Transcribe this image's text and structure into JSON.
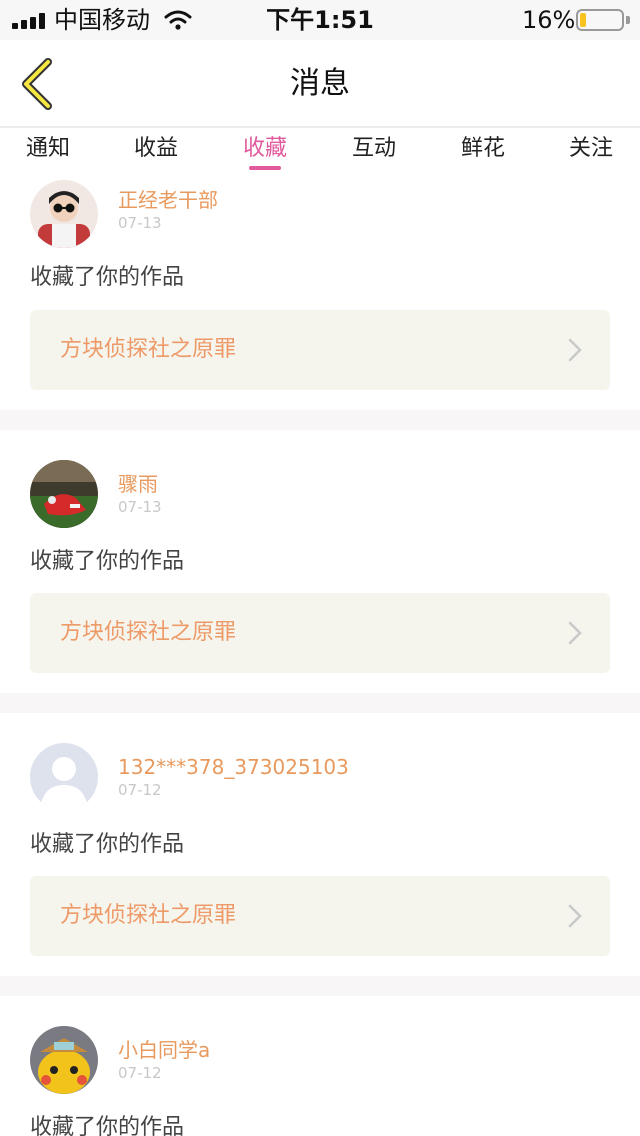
{
  "status_bar": {
    "carrier": "中国移动",
    "time": "下午1:51",
    "battery_percent": "16%",
    "battery_level": 0.16,
    "battery_color": "#f7c31c"
  },
  "nav": {
    "title": "消息",
    "back_icon": "chevron-left-icon"
  },
  "tabs": [
    {
      "label": "通知",
      "active": false
    },
    {
      "label": "收益",
      "active": false
    },
    {
      "label": "收藏",
      "active": true
    },
    {
      "label": "互动",
      "active": false
    },
    {
      "label": "鲜花",
      "active": false
    },
    {
      "label": "关注",
      "active": false
    }
  ],
  "colors": {
    "accent": "#e05a9d",
    "username": "#e89a5e",
    "work_title": "#ee9a68",
    "work_box_bg": "#f5f5ee"
  },
  "feed": [
    {
      "username": "正经老干部",
      "date": "07-13",
      "action": "收藏了你的作品",
      "work_title": "方块侦探社之原罪"
    },
    {
      "username": "骤雨",
      "date": "07-13",
      "action": "收藏了你的作品",
      "work_title": "方块侦探社之原罪"
    },
    {
      "username": "132***378_373025103",
      "date": "07-12",
      "action": "收藏了你的作品",
      "work_title": "方块侦探社之原罪"
    },
    {
      "username": "小白同学a",
      "date": "07-12",
      "action": "收藏了你的作品",
      "work_title": ""
    }
  ]
}
